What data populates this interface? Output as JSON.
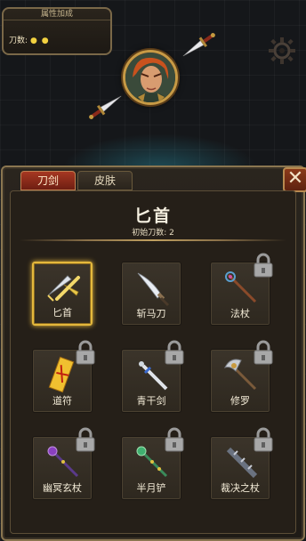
{
  "stats": {
    "title": "属性加成",
    "line_label": "刀数:",
    "dots": "● ●"
  },
  "tabs": [
    {
      "label": "刀剑",
      "active": true
    },
    {
      "label": "皮肤",
      "active": false
    }
  ],
  "close_label": "✕",
  "selected_weapon": {
    "name": "匕首",
    "subtitle": "初始刀数: 2"
  },
  "weapons": [
    {
      "name": "匕首",
      "locked": false,
      "selected": true,
      "icon": "dagger-icon"
    },
    {
      "name": "斩马刀",
      "locked": false,
      "selected": false,
      "icon": "saber-icon"
    },
    {
      "name": "法杖",
      "locked": true,
      "selected": false,
      "icon": "staff-icon"
    },
    {
      "name": "道符",
      "locked": true,
      "selected": false,
      "icon": "talisman-icon"
    },
    {
      "name": "青干剑",
      "locked": true,
      "selected": false,
      "icon": "sword-icon"
    },
    {
      "name": "修罗",
      "locked": true,
      "selected": false,
      "icon": "axe-icon"
    },
    {
      "name": "幽冥玄杖",
      "locked": true,
      "selected": false,
      "icon": "dark-staff-icon"
    },
    {
      "name": "半月铲",
      "locked": true,
      "selected": false,
      "icon": "crescent-spade-icon"
    },
    {
      "name": "裁决之杖",
      "locked": true,
      "selected": false,
      "icon": "judgement-staff-icon"
    }
  ],
  "colors": {
    "accent_gold": "#e4b83c",
    "tab_active": "#a63822",
    "panel_border": "#8a7650"
  }
}
